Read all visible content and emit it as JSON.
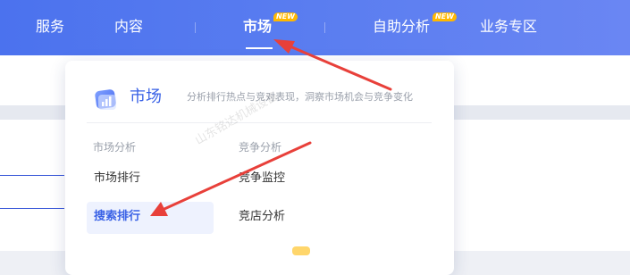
{
  "nav": {
    "items": [
      {
        "label": "服务"
      },
      {
        "label": "内容"
      },
      {
        "label": "市场",
        "badge": "NEW",
        "active": true
      },
      {
        "label": "自助分析",
        "badge": "NEW"
      },
      {
        "label": "业务专区"
      }
    ]
  },
  "dropdown": {
    "title": "市场",
    "description": "分析排行热点与竞对表现，洞察市场机会与竞争变化",
    "groups": [
      {
        "title": "市场分析",
        "items": [
          {
            "label": "市场排行"
          },
          {
            "label": "搜索排行",
            "selected": true
          }
        ]
      },
      {
        "title": "竞争分析",
        "items": [
          {
            "label": "竞争监控"
          },
          {
            "label": "竞店分析"
          }
        ]
      }
    ]
  },
  "watermark": "山东铭达机械设备",
  "colors": {
    "nav_gradient_start": "#4b72ee",
    "nav_gradient_end": "#6a86f3",
    "accent": "#3a62e6",
    "badge": "#ffb800",
    "annotation_arrow": "#e8403a"
  },
  "icons": {
    "dropdown_logo": "market-chart-icon"
  }
}
